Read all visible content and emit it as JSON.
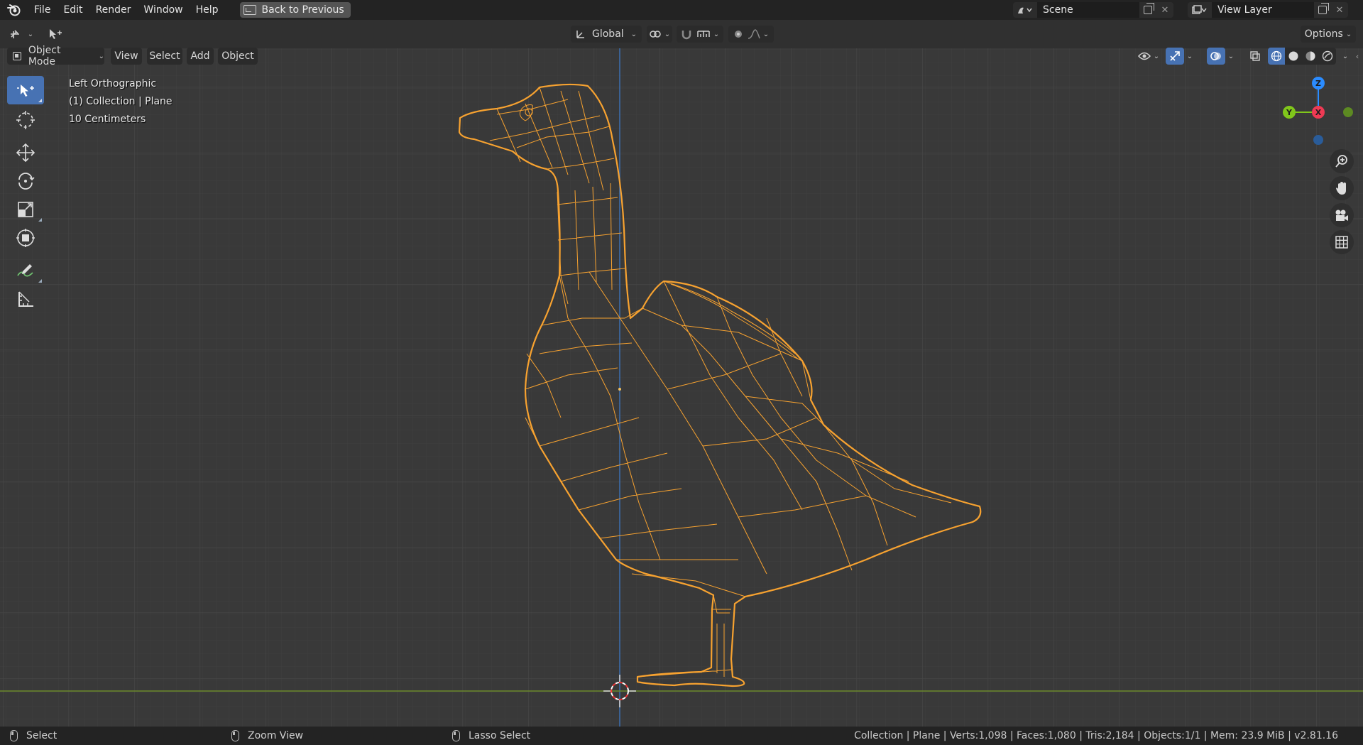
{
  "menu": {
    "items": [
      "File",
      "Edit",
      "Render",
      "Window",
      "Help"
    ],
    "back_button": "Back to Previous"
  },
  "scene": {
    "name": "Scene",
    "view_layer": "View Layer"
  },
  "header": {
    "transform_orientation": "Global",
    "options_label": "Options",
    "mode": "Object Mode",
    "menus": [
      "View",
      "Select",
      "Add",
      "Object"
    ]
  },
  "overlay": {
    "view_name": "Left Orthographic",
    "collection": "(1) Collection | Plane",
    "scale": "10 Centimeters"
  },
  "gizmo": {
    "z": "Z",
    "y": "Y",
    "x": "X"
  },
  "status": {
    "select": "Select",
    "zoom": "Zoom View",
    "lasso": "Lasso Select",
    "stats": "Collection | Plane | Verts:1,098 | Faces:1,080 | Tris:2,184 | Objects:1/1 | Mem: 23.9 MiB | v2.81.16"
  },
  "colors": {
    "accent": "#4772b3",
    "selection": "#f7a230",
    "axis_x": "#ee3a54",
    "axis_y": "#80c61b",
    "axis_z": "#2b8cff"
  }
}
